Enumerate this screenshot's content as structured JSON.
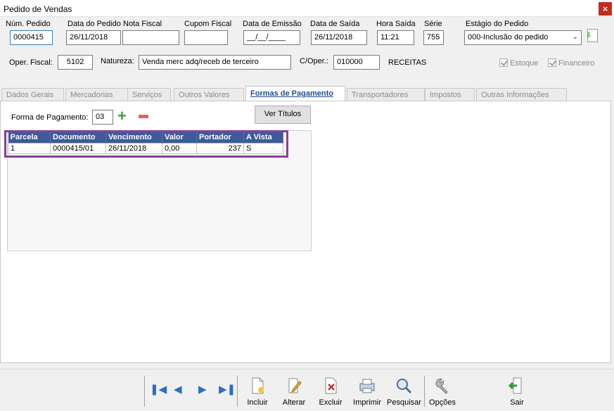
{
  "window": {
    "title": "Pedido de Vendas",
    "close_glyph": "×"
  },
  "header": {
    "num_pedido": {
      "label": "Núm. Pedido",
      "value": "0000415"
    },
    "data_pedido": {
      "label": "Data do Pedido",
      "value": "26/11/2018"
    },
    "nota_fiscal": {
      "label": "Nota Fiscal",
      "value": ""
    },
    "cupom_fiscal": {
      "label": "Cupom Fiscal",
      "value": ""
    },
    "data_emissao": {
      "label": "Data de Emissão",
      "value": "__/__/____"
    },
    "data_saida": {
      "label": "Data de Saída",
      "value": "26/11/2018"
    },
    "hora_saida": {
      "label": "Hora Saída",
      "value": "11:21"
    },
    "serie": {
      "label": "Série",
      "value": "755"
    },
    "estagio": {
      "label": "Estágio do Pedido",
      "value": "000-Inclusão do pedido"
    },
    "oper_fiscal": {
      "label": "Oper. Fiscal:",
      "value": "5102"
    },
    "natureza": {
      "label": "Natureza:",
      "value": "Venda merc adq/receb de terceiro"
    },
    "c_oper": {
      "label": "C/Oper.:",
      "value": "010000"
    },
    "receitas": "RECEITAS",
    "estoque": "Estoque",
    "financeiro": "Financeiro"
  },
  "tabs": [
    {
      "label": "Dados Gerais"
    },
    {
      "label": "Mercadorias"
    },
    {
      "label": "Serviços"
    },
    {
      "label": "Outros Valores"
    },
    {
      "label": "Formas de Pagamento"
    },
    {
      "label": "Transportadores"
    },
    {
      "label": "Impostos"
    },
    {
      "label": "Outras Informações"
    }
  ],
  "payment": {
    "forma_label": "Forma de Pagamento:",
    "forma_value": "03",
    "ver_titulos": "Ver Títulos",
    "columns": [
      "Parcela",
      "Documento",
      "Vencimento",
      "Valor",
      "Portador",
      "A Vista"
    ],
    "rows": [
      {
        "parcela": "1",
        "documento": "0000415/01",
        "vencimento": "26/11/2018",
        "valor": "0,00",
        "portador": "237",
        "a_vista": "S"
      }
    ]
  },
  "toolbar": {
    "incluir": "Incluir",
    "alterar": "Alterar",
    "excluir": "Excluir",
    "imprimir": "Imprimir",
    "pesquisar": "Pesquisar",
    "opcoes": "Opções",
    "sair": "Sair"
  }
}
